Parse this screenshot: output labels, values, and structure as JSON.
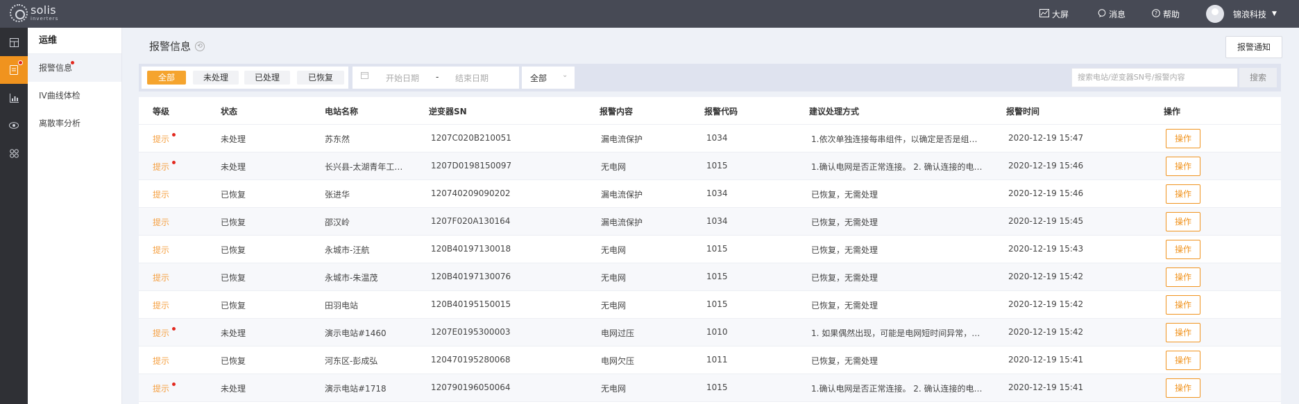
{
  "topbar": {
    "logo_text": "solis",
    "logo_sub": "inverters",
    "nav": [
      {
        "icon": "chart-line-icon",
        "label": "大屏"
      },
      {
        "icon": "message-icon",
        "label": "消息"
      },
      {
        "icon": "help-icon",
        "label": "帮助"
      }
    ],
    "user_name": "锦浪科技"
  },
  "rail": {
    "items": [
      "dashboard-icon",
      "alarm-icon",
      "report-icon",
      "eye-icon",
      "apps-icon"
    ],
    "active_index": 1
  },
  "subnav": {
    "title": "运维",
    "items": [
      {
        "label": "报警信息",
        "active": true,
        "dot": true
      },
      {
        "label": "IV曲线体检",
        "active": false,
        "dot": false
      },
      {
        "label": "离散率分析",
        "active": false,
        "dot": false
      }
    ]
  },
  "page": {
    "title": "报警信息",
    "notify_button": "报警通知"
  },
  "filters": {
    "tabs": [
      "全部",
      "未处理",
      "已处理",
      "已恢复"
    ],
    "active_tab": 0,
    "start_placeholder": "开始日期",
    "date_sep": "-",
    "end_placeholder": "结束日期",
    "level_select": "全部",
    "search_placeholder": "搜索电站/逆变器SN号/报警内容",
    "search_button": "搜索"
  },
  "table": {
    "columns": [
      "等级",
      "状态",
      "电站名称",
      "逆变器SN",
      "报警内容",
      "报警代码",
      "建议处理方式",
      "报警时间",
      "操作"
    ],
    "rows": [
      {
        "level": "提示",
        "dot": true,
        "status": "未处理",
        "station": "苏东然",
        "sn": "1207C020B210051",
        "content": "漏电流保护",
        "code": "1034",
        "advice": "1.依次单独连接每串组件，以确定是否是组件…",
        "time": "2020-12-19 15:47",
        "op": "操作"
      },
      {
        "level": "提示",
        "dot": true,
        "status": "未处理",
        "station": "长兴县-太湖青年工…",
        "sn": "1207D0198150097",
        "content": "无电网",
        "code": "1015",
        "advice": "1.确认电网是否正常连接。 2. 确认连接的电…",
        "time": "2020-12-19 15:46",
        "op": "操作"
      },
      {
        "level": "提示",
        "dot": false,
        "status": "已恢复",
        "station": "张进华",
        "sn": "120740209090202",
        "content": "漏电流保护",
        "code": "1034",
        "advice": "已恢复，无需处理",
        "time": "2020-12-19 15:46",
        "op": "操作"
      },
      {
        "level": "提示",
        "dot": false,
        "status": "已恢复",
        "station": "邵汉岭",
        "sn": "1207F020A130164",
        "content": "漏电流保护",
        "code": "1034",
        "advice": "已恢复，无需处理",
        "time": "2020-12-19 15:45",
        "op": "操作"
      },
      {
        "level": "提示",
        "dot": false,
        "status": "已恢复",
        "station": "永城市-汪航",
        "sn": "120B40197130018",
        "content": "无电网",
        "code": "1015",
        "advice": "已恢复，无需处理",
        "time": "2020-12-19 15:43",
        "op": "操作"
      },
      {
        "level": "提示",
        "dot": false,
        "status": "已恢复",
        "station": "永城市-朱温茂",
        "sn": "120B40197130076",
        "content": "无电网",
        "code": "1015",
        "advice": "已恢复，无需处理",
        "time": "2020-12-19 15:42",
        "op": "操作"
      },
      {
        "level": "提示",
        "dot": false,
        "status": "已恢复",
        "station": "田羽电站",
        "sn": "120B40195150015",
        "content": "无电网",
        "code": "1015",
        "advice": "已恢复，无需处理",
        "time": "2020-12-19 15:42",
        "op": "操作"
      },
      {
        "level": "提示",
        "dot": true,
        "status": "未处理",
        "station": "演示电站#1460",
        "sn": "1207E0195300003",
        "content": "电网过压",
        "code": "1010",
        "advice": "1. 如果偶然出现，可能是电网短时间异常，逆…",
        "time": "2020-12-19 15:42",
        "op": "操作"
      },
      {
        "level": "提示",
        "dot": false,
        "status": "已恢复",
        "station": "河东区-彭成弘",
        "sn": "120470195280068",
        "content": "电网欠压",
        "code": "1011",
        "advice": "已恢复，无需处理",
        "time": "2020-12-19 15:41",
        "op": "操作"
      },
      {
        "level": "提示",
        "dot": true,
        "status": "未处理",
        "station": "演示电站#1718",
        "sn": "120790196050064",
        "content": "无电网",
        "code": "1015",
        "advice": "1.确认电网是否正常连接。 2. 确认连接的电…",
        "time": "2020-12-19 15:41",
        "op": "操作"
      }
    ]
  }
}
